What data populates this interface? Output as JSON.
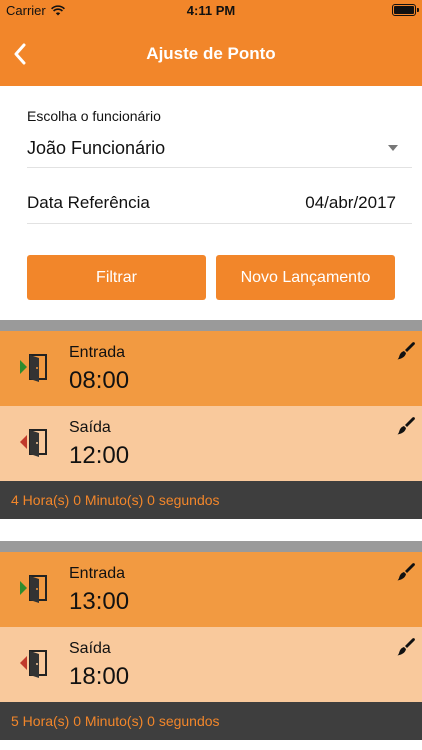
{
  "status_bar": {
    "carrier": "Carrier",
    "time": "4:11 PM"
  },
  "nav": {
    "title": "Ajuste de Ponto"
  },
  "form": {
    "employee_label": "Escolha o funcionário",
    "employee_value": "João Funcionário",
    "date_label": "Data Referência",
    "date_value": "04/abr/2017"
  },
  "buttons": {
    "filter": "Filtrar",
    "new_entry": "Novo Lançamento"
  },
  "groups": [
    {
      "entries": [
        {
          "type": "Entrada",
          "time": "08:00"
        },
        {
          "type": "Saída",
          "time": "12:00"
        }
      ],
      "total": "4 Hora(s) 0 Minuto(s) 0 segundos"
    },
    {
      "entries": [
        {
          "type": "Entrada",
          "time": "13:00"
        },
        {
          "type": "Saída",
          "time": "18:00"
        }
      ],
      "total": "5 Hora(s) 0 Minuto(s) 0 segundos"
    }
  ],
  "colors": {
    "accent": "#f2862a",
    "entry_in_bg": "#f29a41",
    "entry_out_bg": "#f9c99c",
    "total_bg": "#3e3e3e",
    "arrow_in": "#2e8b2e",
    "arrow_out": "#c0392b"
  },
  "icons": {
    "back": "chevron-left-icon",
    "door_in": "door-enter-icon",
    "door_out": "door-exit-icon",
    "edit": "paintbrush-icon"
  }
}
